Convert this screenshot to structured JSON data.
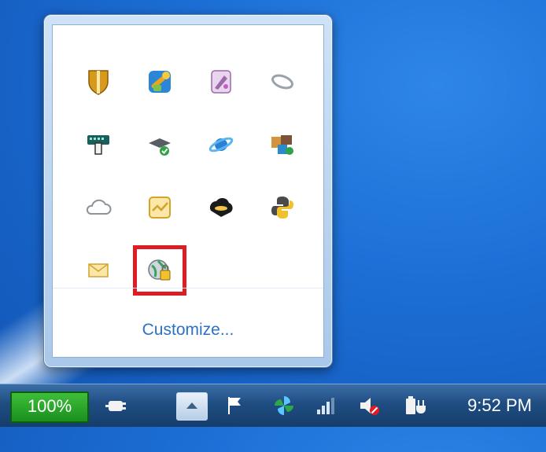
{
  "flyout": {
    "customize_label": "Customize...",
    "icons": [
      {
        "name": "shield-icon"
      },
      {
        "name": "tools-icon"
      },
      {
        "name": "paint-icon"
      },
      {
        "name": "ring-icon"
      },
      {
        "name": "keyboard-hand-icon"
      },
      {
        "name": "graduation-cap-icon"
      },
      {
        "name": "orbit-icon"
      },
      {
        "name": "app-cubes-icon"
      },
      {
        "name": "cloud-icon"
      },
      {
        "name": "chart-note-icon"
      },
      {
        "name": "black-cloud-icon"
      },
      {
        "name": "python-icon"
      },
      {
        "name": "envelope-icon"
      },
      {
        "name": "globe-lock-icon",
        "selected": true
      }
    ]
  },
  "taskbar": {
    "battery_label": "100%",
    "clock": "9:52 PM",
    "icons": [
      "power-plug-icon",
      "flag-icon",
      "pinwheel-icon",
      "signal-icon",
      "speaker-muted-icon",
      "battery-plug-icon"
    ]
  },
  "colors": {
    "highlight": "#e01b23",
    "desktop": "#1c6fd6",
    "link": "#2a72c4"
  }
}
